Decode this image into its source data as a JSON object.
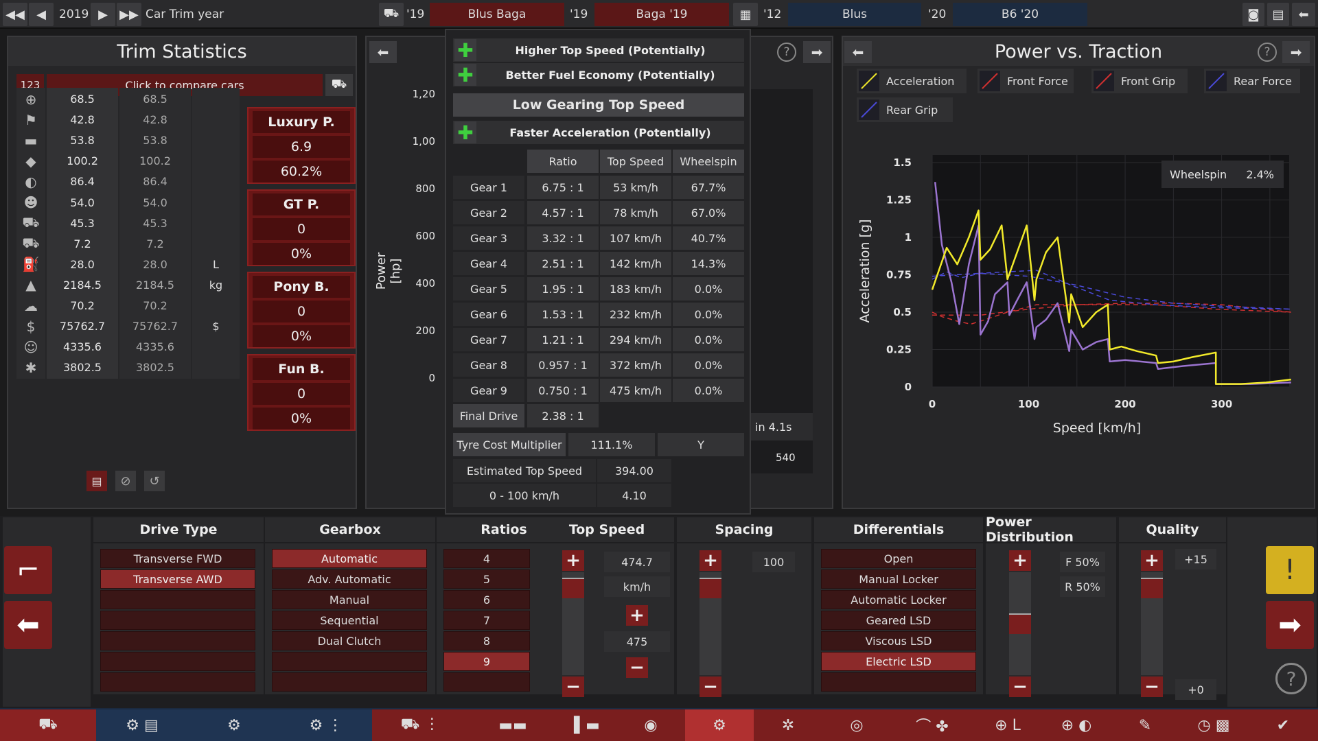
{
  "topbar": {
    "year": "2019",
    "car_trim_year_label": "Car Trim year",
    "car1_year": "'19",
    "car1_name": "Blus Baga",
    "car2_year": "'19",
    "car2_name": "Baga '19",
    "engine1_year": "'12",
    "engine1_name": "Blus",
    "engine2_year": "'20",
    "engine2_name": "B6 '20"
  },
  "trim_stats": {
    "title": "Trim Statistics",
    "compare_count": "123",
    "compare_label": "Click to compare cars",
    "rows": [
      {
        "icon": "steering-wheel-icon",
        "v1": "68.5",
        "v2": "68.5",
        "unit": ""
      },
      {
        "icon": "race-flag-icon",
        "v1": "42.8",
        "v2": "42.8",
        "unit": ""
      },
      {
        "icon": "seat-icon",
        "v1": "53.8",
        "v2": "53.8",
        "unit": ""
      },
      {
        "icon": "gem-icon",
        "v1": "100.2",
        "v2": "100.2",
        "unit": ""
      },
      {
        "icon": "safety-icon",
        "v1": "86.4",
        "v2": "86.4",
        "unit": ""
      },
      {
        "icon": "passengers-icon",
        "v1": "54.0",
        "v2": "54.0",
        "unit": ""
      },
      {
        "icon": "cargo-car-icon",
        "v1": "45.3",
        "v2": "45.3",
        "unit": ""
      },
      {
        "icon": "offroad-car-icon",
        "v1": "7.2",
        "v2": "7.2",
        "unit": ""
      },
      {
        "icon": "fuel-pump-icon",
        "v1": "28.0",
        "v2": "28.0",
        "unit": "L"
      },
      {
        "icon": "weight-icon",
        "v1": "2184.5",
        "v2": "2184.5",
        "unit": "kg"
      },
      {
        "icon": "environment-icon",
        "v1": "70.2",
        "v2": "70.2",
        "unit": ""
      },
      {
        "icon": "money-bag-icon",
        "v1": "75762.7",
        "v2": "75762.7",
        "unit": "$"
      },
      {
        "icon": "workers-icon",
        "v1": "4335.6",
        "v2": "4335.6",
        "unit": ""
      },
      {
        "icon": "service-icon",
        "v1": "3802.5",
        "v2": "3802.5",
        "unit": ""
      }
    ],
    "demographics": [
      {
        "name": "Luxury P.",
        "score": "6.9",
        "pct": "60.2%"
      },
      {
        "name": "GT P.",
        "score": "0",
        "pct": "0%"
      },
      {
        "name": "Pony B.",
        "score": "0",
        "pct": "0%"
      },
      {
        "name": "Fun B.",
        "score": "0",
        "pct": "0%"
      }
    ]
  },
  "middle_chart": {
    "y_axis_label": "Power [hp]",
    "y_ticks": [
      "1,20",
      "1,00",
      "800",
      "600",
      "400",
      "200",
      "0"
    ],
    "x_tick_right": "540",
    "overlay_text": "in 4.1s"
  },
  "gearing": {
    "benefits_top": [
      "Higher Top Speed (Potentially)",
      "Better Fuel Economy (Potentially)"
    ],
    "section_title": "Low Gearing Top Speed",
    "benefit_bottom": "Faster Acceleration (Potentially)",
    "headers": [
      "Ratio",
      "Top Speed",
      "Wheelspin"
    ],
    "gears": [
      {
        "name": "Gear 1",
        "ratio": "6.75 : 1",
        "speed": "53 km/h",
        "wheelspin": "67.7%"
      },
      {
        "name": "Gear 2",
        "ratio": "4.57 : 1",
        "speed": "78 km/h",
        "wheelspin": "67.0%"
      },
      {
        "name": "Gear 3",
        "ratio": "3.32 : 1",
        "speed": "107 km/h",
        "wheelspin": "40.7%"
      },
      {
        "name": "Gear 4",
        "ratio": "2.51 : 1",
        "speed": "142 km/h",
        "wheelspin": "14.3%"
      },
      {
        "name": "Gear 5",
        "ratio": "1.95 : 1",
        "speed": "183 km/h",
        "wheelspin": "0.0%"
      },
      {
        "name": "Gear 6",
        "ratio": "1.53 : 1",
        "speed": "232 km/h",
        "wheelspin": "0.0%"
      },
      {
        "name": "Gear 7",
        "ratio": "1.21 : 1",
        "speed": "294 km/h",
        "wheelspin": "0.0%"
      },
      {
        "name": "Gear 8",
        "ratio": "0.957 : 1",
        "speed": "372 km/h",
        "wheelspin": "0.0%"
      },
      {
        "name": "Gear 9",
        "ratio": "0.750 : 1",
        "speed": "475 km/h",
        "wheelspin": "0.0%"
      }
    ],
    "final_drive_label": "Final Drive",
    "final_drive_value": "2.38 : 1",
    "tyre_cost_label": "Tyre Cost Multiplier",
    "tyre_cost_value": "111.1%",
    "tyre_cost_flag": "Y",
    "est_top_speed_label": "Estimated Top Speed",
    "est_top_speed_value": "394.00",
    "accel_label": "0 - 100 km/h",
    "accel_value": "4.10"
  },
  "power_traction": {
    "title": "Power vs. Traction",
    "legend": [
      {
        "name": "Acceleration",
        "color": "#f2ea2a"
      },
      {
        "name": "Front Force",
        "color": "#d03030"
      },
      {
        "name": "Front Grip",
        "color": "#d03030"
      },
      {
        "name": "Rear Force",
        "color": "#4a4ad8"
      },
      {
        "name": "Rear Grip",
        "color": "#4a4ad8"
      }
    ],
    "wheelspin_label": "Wheelspin",
    "wheelspin_value": "2.4%"
  },
  "chart_data": {
    "type": "line",
    "xlabel": "Speed [km/h]",
    "ylabel": "Acceleration [g]",
    "xlim": [
      0,
      370
    ],
    "ylim": [
      0,
      1.55
    ],
    "x_ticks": [
      "0",
      "100",
      "200",
      "300"
    ],
    "y_ticks": [
      "1.5",
      "1.25",
      "1",
      "0.75",
      "0.5",
      "0.25",
      "0"
    ],
    "grid": true,
    "series": [
      {
        "name": "Acceleration",
        "color": "#f2ea2a",
        "dash": false,
        "x": [
          0,
          15,
          26,
          38,
          48,
          50,
          60,
          72,
          78,
          88,
          98,
          106,
          108,
          118,
          130,
          142,
          144,
          156,
          170,
          182,
          184,
          196,
          212,
          232,
          234,
          250,
          270,
          294,
          294,
          320,
          346,
          372
        ],
        "y": [
          0.65,
          0.93,
          0.82,
          1.0,
          1.18,
          0.85,
          0.92,
          1.08,
          0.72,
          0.9,
          1.08,
          0.58,
          0.72,
          0.9,
          1.0,
          0.43,
          0.62,
          0.4,
          0.5,
          0.55,
          0.25,
          0.27,
          0.24,
          0.21,
          0.16,
          0.17,
          0.2,
          0.23,
          0.02,
          0.02,
          0.03,
          0.05
        ]
      },
      {
        "name": "Front Force",
        "color": "#d03030",
        "dash": true,
        "x": [
          0,
          10,
          26,
          40,
          50,
          78,
          108,
          144,
          184,
          232,
          294,
          372
        ],
        "y": [
          0.5,
          0.47,
          0.44,
          0.42,
          0.44,
          0.5,
          0.55,
          0.55,
          0.55,
          0.55,
          0.52,
          0.5
        ]
      },
      {
        "name": "Front Grip",
        "color": "#d03030",
        "dash": true,
        "x": [
          0,
          50,
          100,
          150,
          200,
          250,
          300,
          372
        ],
        "y": [
          0.48,
          0.48,
          0.52,
          0.55,
          0.56,
          0.56,
          0.55,
          0.5
        ]
      },
      {
        "name": "Rear Force",
        "color": "#4a4ad8",
        "dash": true,
        "x": [
          0,
          15,
          30,
          50,
          78,
          108,
          144,
          184,
          232,
          294,
          372
        ],
        "y": [
          0.72,
          0.77,
          0.73,
          0.76,
          0.77,
          0.78,
          0.68,
          0.58,
          0.55,
          0.53,
          0.52
        ]
      },
      {
        "name": "Rear Grip",
        "color": "#4a4ad8",
        "dash": true,
        "x": [
          0,
          50,
          100,
          150,
          200,
          250,
          300,
          372
        ],
        "y": [
          0.74,
          0.76,
          0.74,
          0.68,
          0.6,
          0.56,
          0.54,
          0.52
        ]
      },
      {
        "name": "Wheelspin trace",
        "color": "#9b74d0",
        "dash": false,
        "x": [
          3,
          10,
          20,
          28,
          38,
          48,
          50,
          58,
          65,
          78,
          80,
          88,
          98,
          106,
          108,
          118,
          130,
          142,
          144,
          156,
          170,
          182,
          184,
          200,
          232,
          234,
          260,
          294,
          294,
          330,
          372
        ],
        "y": [
          1.37,
          0.95,
          0.7,
          0.42,
          0.82,
          1.08,
          0.35,
          0.44,
          0.62,
          0.7,
          0.48,
          0.58,
          0.7,
          0.32,
          0.4,
          0.45,
          0.56,
          0.24,
          0.38,
          0.25,
          0.3,
          0.32,
          0.17,
          0.18,
          0.16,
          0.12,
          0.14,
          0.16,
          0.02,
          0.02,
          0.03
        ]
      }
    ]
  },
  "bottom": {
    "columns": [
      "Drive Type",
      "Gearbox",
      "Ratios",
      "Top Speed",
      "Spacing",
      "Differentials",
      "Power Distribution",
      "Quality"
    ],
    "drive_types": [
      "Transverse FWD",
      "Transverse AWD"
    ],
    "drive_selected": 1,
    "gearboxes": [
      "Automatic",
      "Adv. Automatic",
      "Manual",
      "Sequential",
      "Dual Clutch"
    ],
    "gearbox_selected": 0,
    "ratios": [
      "4",
      "5",
      "6",
      "7",
      "8",
      "9"
    ],
    "ratio_selected": 5,
    "top_speed_value": "474.7",
    "top_speed_unit": "km/h",
    "top_speed_limit": "475",
    "spacing_value": "100",
    "differentials": [
      "Open",
      "Manual Locker",
      "Automatic Locker",
      "Geared LSD",
      "Viscous LSD",
      "Electric LSD"
    ],
    "diff_selected": 5,
    "power_front": "F 50%",
    "power_rear": "R 50%",
    "quality_top": "+15",
    "quality_bottom": "+0"
  }
}
